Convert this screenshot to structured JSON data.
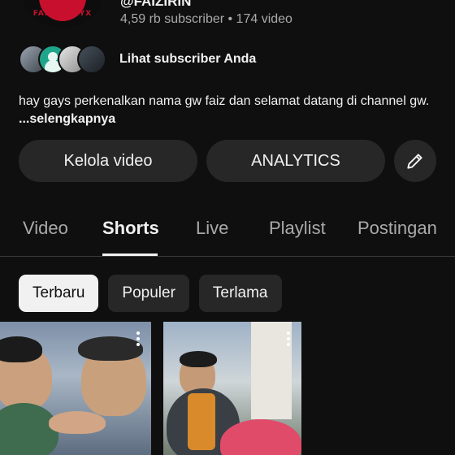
{
  "channel": {
    "handle": "@FAIZIRIN",
    "stats": "4,59 rb subscriber • 174 video",
    "avatar_text": "FAIZ IZYYYX"
  },
  "subscribers": {
    "link_label": "Lihat subscriber Anda"
  },
  "description": {
    "text": "hay gays perkenalkan nama gw faiz dan selamat datang di channel gw.",
    "more_label": "...selengkapnya"
  },
  "actions": {
    "manage_label": "Kelola video",
    "analytics_label": "ANALYTICS",
    "edit_icon": "pencil-icon"
  },
  "tabs": [
    {
      "label": "Video",
      "active": false
    },
    {
      "label": "Shorts",
      "active": true
    },
    {
      "label": "Live",
      "active": false
    },
    {
      "label": "Playlist",
      "active": false
    },
    {
      "label": "Postingan",
      "active": false
    }
  ],
  "filters": [
    {
      "label": "Terbaru",
      "active": true
    },
    {
      "label": "Populer",
      "active": false
    },
    {
      "label": "Terlama",
      "active": false
    }
  ],
  "colors": {
    "background": "#0f0f0f",
    "surface": "#272727",
    "text_primary": "#f1f1f1",
    "text_secondary": "#aaaaaa",
    "logo_red": "#c8102e"
  }
}
